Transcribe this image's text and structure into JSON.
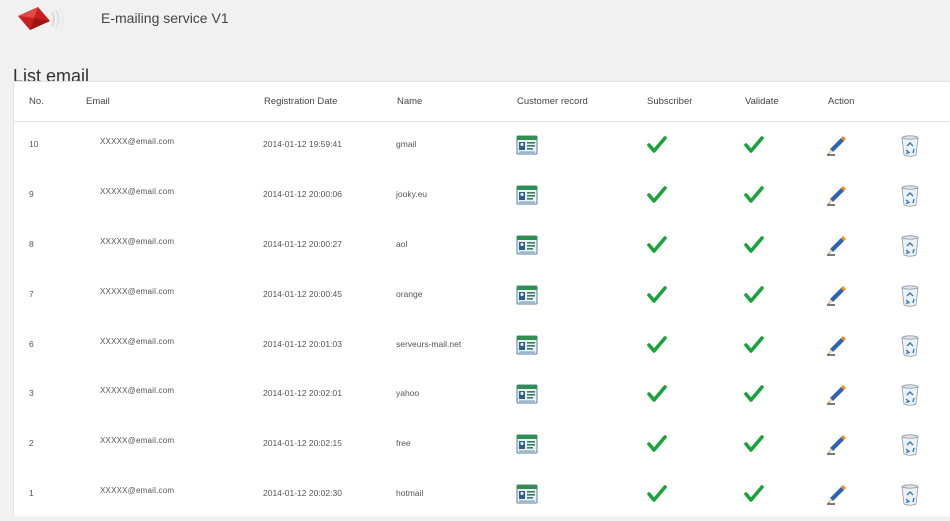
{
  "header": {
    "app_title": "E-mailing service V1",
    "logo_icon": "envelope-logo-icon"
  },
  "page": {
    "title": "List email"
  },
  "table": {
    "columns": [
      "No.",
      "Email",
      "Registration Date",
      "Name",
      "Customer record",
      "Subscriber",
      "Validate",
      "Action"
    ],
    "rows": [
      {
        "no": "10",
        "email": "XXXXX@email.com",
        "date": "2014-01-12 19:59:41",
        "name": "gmail"
      },
      {
        "no": "9",
        "email": "XXXXX@email.com",
        "date": "2014-01-12 20:00:06",
        "name": "jooky.eu"
      },
      {
        "no": "8",
        "email": "XXXXX@email.com",
        "date": "2014-01-12 20:00:27",
        "name": "aol"
      },
      {
        "no": "7",
        "email": "XXXXX@email.com",
        "date": "2014-01-12 20:00:45",
        "name": "orange"
      },
      {
        "no": "6",
        "email": "XXXXX@email.com",
        "date": "2014-01-12 20:01:03",
        "name": "serveurs-mail.net"
      },
      {
        "no": "3",
        "email": "XXXXX@email.com",
        "date": "2014-01-12 20:02:01",
        "name": "yahoo"
      },
      {
        "no": "2",
        "email": "XXXXX@email.com",
        "date": "2014-01-12 20:02:15",
        "name": "free"
      },
      {
        "no": "1",
        "email": "XXXXX@email.com",
        "date": "2014-01-12 20:02:30",
        "name": "hotmail"
      }
    ],
    "icons": {
      "customer_record": "contact-card-icon",
      "subscriber": "green-checkmark-icon",
      "validate": "green-checkmark-icon",
      "edit": "pencil-edit-icon",
      "delete": "recycle-bin-icon"
    }
  },
  "colors": {
    "background": "#f1f1f1",
    "panel": "#ffffff",
    "check_green": "#1aa33a",
    "logo_red": "#c8201f"
  }
}
